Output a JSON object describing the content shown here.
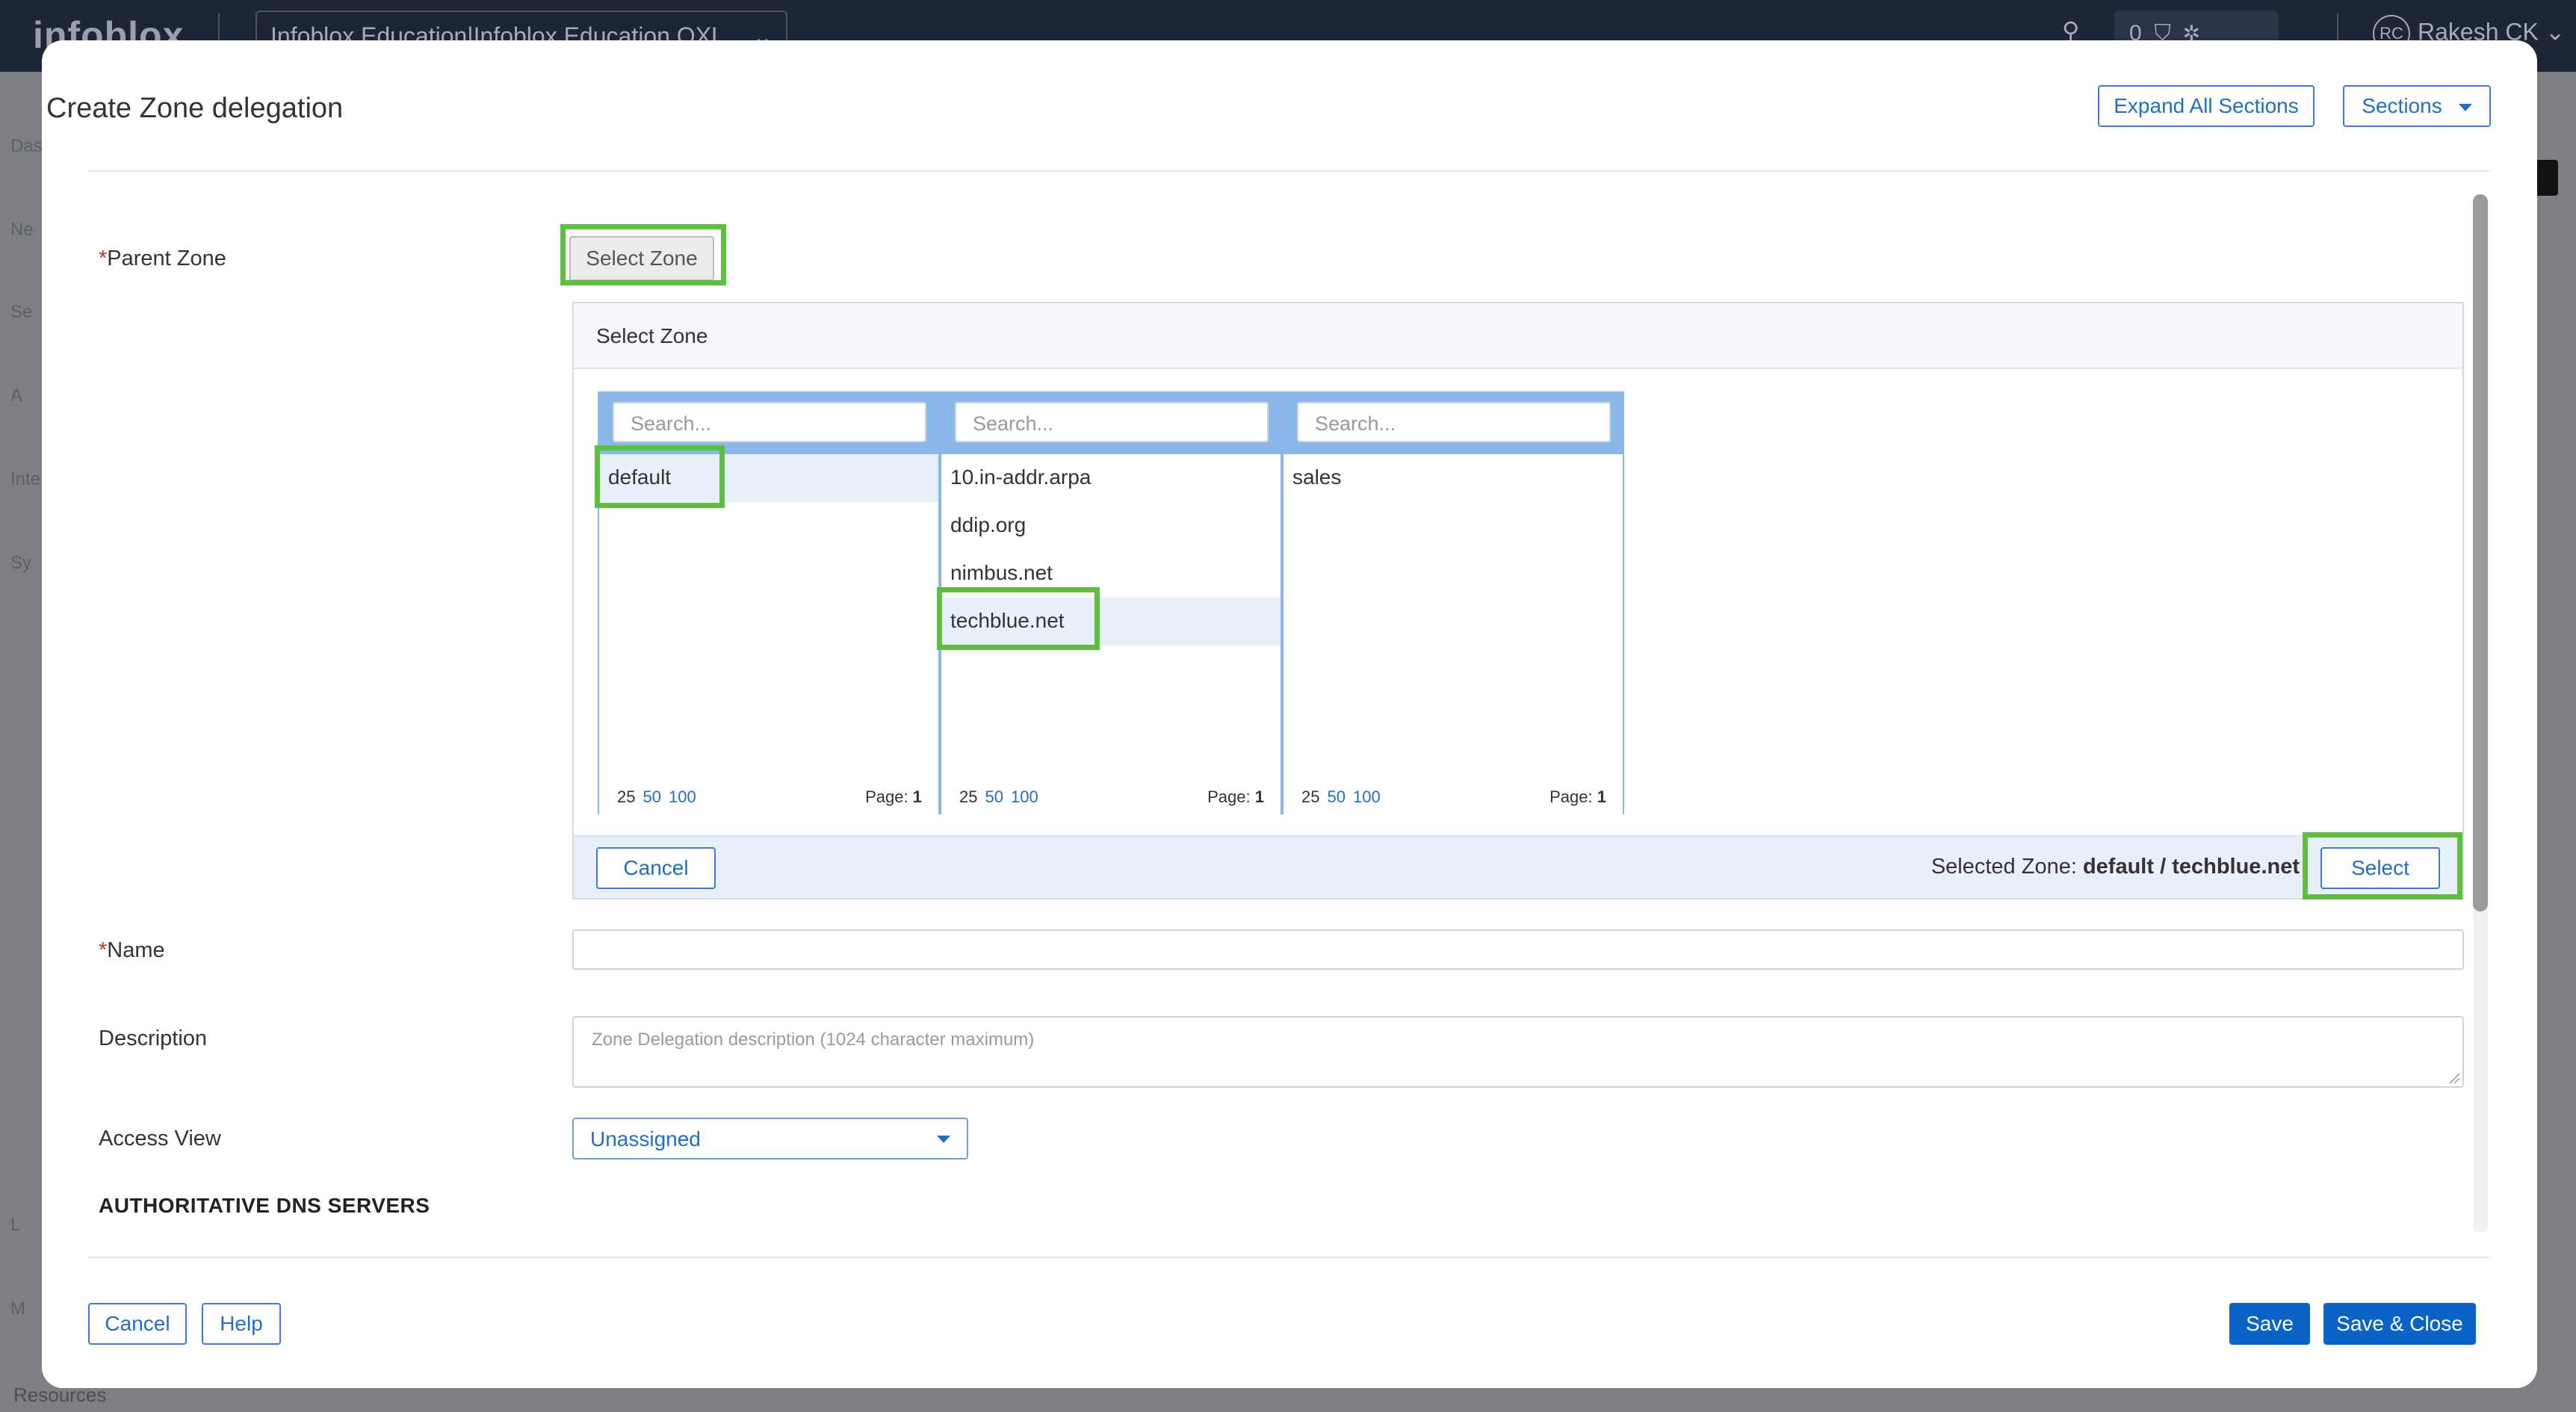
{
  "background": {
    "logo": "infoblox",
    "account": "Infoblox Education|Infoblox Education QXL",
    "notification_count": "0",
    "user_initials": "RC",
    "user_name": "Rakesh CK",
    "side_fragments": [
      "Das",
      "Ne",
      "Se",
      "A",
      "Inte",
      "Sy",
      "L",
      "M"
    ],
    "resources": "Resources"
  },
  "modal": {
    "title": "Create Zone delegation",
    "expand_all_label": "Expand All Sections",
    "sections_label": "Sections",
    "parent_zone": {
      "label": "Parent Zone",
      "required_mark": "*",
      "button_label": "Select Zone"
    },
    "picker": {
      "title": "Select Zone",
      "columns": [
        {
          "search_placeholder": "Search...",
          "items": [
            {
              "label": "default"
            }
          ],
          "page_sizes": [
            "25",
            "50",
            "100"
          ],
          "page_label": "Page:",
          "page_number": "1"
        },
        {
          "search_placeholder": "Search...",
          "items": [
            {
              "label": "10.in-addr.arpa"
            },
            {
              "label": "ddip.org"
            },
            {
              "label": "nimbus.net"
            },
            {
              "label": "techblue.net"
            }
          ],
          "page_sizes": [
            "25",
            "50",
            "100"
          ],
          "page_label": "Page:",
          "page_number": "1"
        },
        {
          "search_placeholder": "Search...",
          "items": [
            {
              "label": "sales"
            }
          ],
          "page_sizes": [
            "25",
            "50",
            "100"
          ],
          "page_label": "Page:",
          "page_number": "1"
        }
      ],
      "cancel_label": "Cancel",
      "selected_zone_label": "Selected Zone:",
      "selected_zone_value": "default / techblue.net",
      "select_label": "Select"
    },
    "name": {
      "label": "Name",
      "required_mark": "*",
      "value": ""
    },
    "description": {
      "label": "Description",
      "placeholder": "Zone Delegation description (1024 character maximum)"
    },
    "access_view": {
      "label": "Access View",
      "value": "Unassigned"
    },
    "section_heading": "AUTHORITATIVE DNS SERVERS",
    "footer": {
      "cancel_label": "Cancel",
      "help_label": "Help",
      "save_label": "Save",
      "save_close_label": "Save & Close"
    },
    "highlight_color": "#5cc03c",
    "accent_color": "#0a64c8"
  }
}
